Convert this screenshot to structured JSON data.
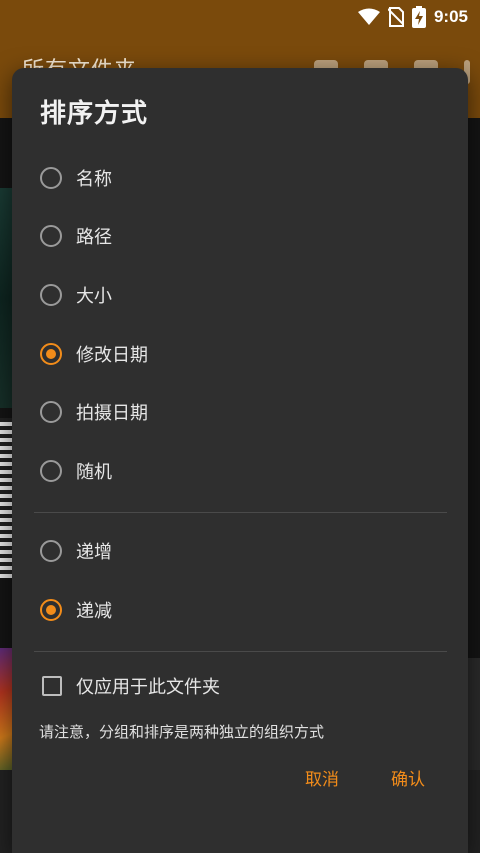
{
  "status_bar": {
    "time": "9:05"
  },
  "app_bar": {
    "title": "所有文件夹"
  },
  "dialog": {
    "title": "排序方式",
    "sort_options": [
      {
        "label": "名称",
        "selected": false
      },
      {
        "label": "路径",
        "selected": false
      },
      {
        "label": "大小",
        "selected": false
      },
      {
        "label": "修改日期",
        "selected": true
      },
      {
        "label": "拍摄日期",
        "selected": false
      },
      {
        "label": "随机",
        "selected": false
      }
    ],
    "order_options": [
      {
        "label": "递增",
        "selected": false
      },
      {
        "label": "递减",
        "selected": true
      }
    ],
    "apply_folder_only": {
      "label": "仅应用于此文件夹",
      "checked": false
    },
    "note": "请注意，分组和排序是两种独立的组织方式",
    "cancel_label": "取消",
    "confirm_label": "确认"
  },
  "colors": {
    "accent": "#f28c1a",
    "app_bar": "#7a4a0c",
    "dialog_bg": "#2f2f2f"
  }
}
